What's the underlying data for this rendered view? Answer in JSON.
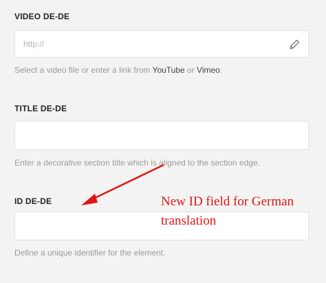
{
  "video": {
    "label": "VIDEO DE-DE",
    "placeholder": "http://",
    "help_prefix": "Select a video file or enter a link from ",
    "help_link1": "YouTube",
    "help_or": " or ",
    "help_link2": "Vimeo",
    "help_suffix": ".",
    "icon": "pencil-icon"
  },
  "title": {
    "label": "TITLE DE-DE",
    "value": "",
    "help": "Enter a decorative section title which is aligned to the section edge."
  },
  "id": {
    "label": "ID DE-DE",
    "value": "",
    "help": "Define a unique identifier for the element."
  },
  "annotation": {
    "line1": "New ID field for German",
    "line2": "translation",
    "color": "#e01515"
  }
}
